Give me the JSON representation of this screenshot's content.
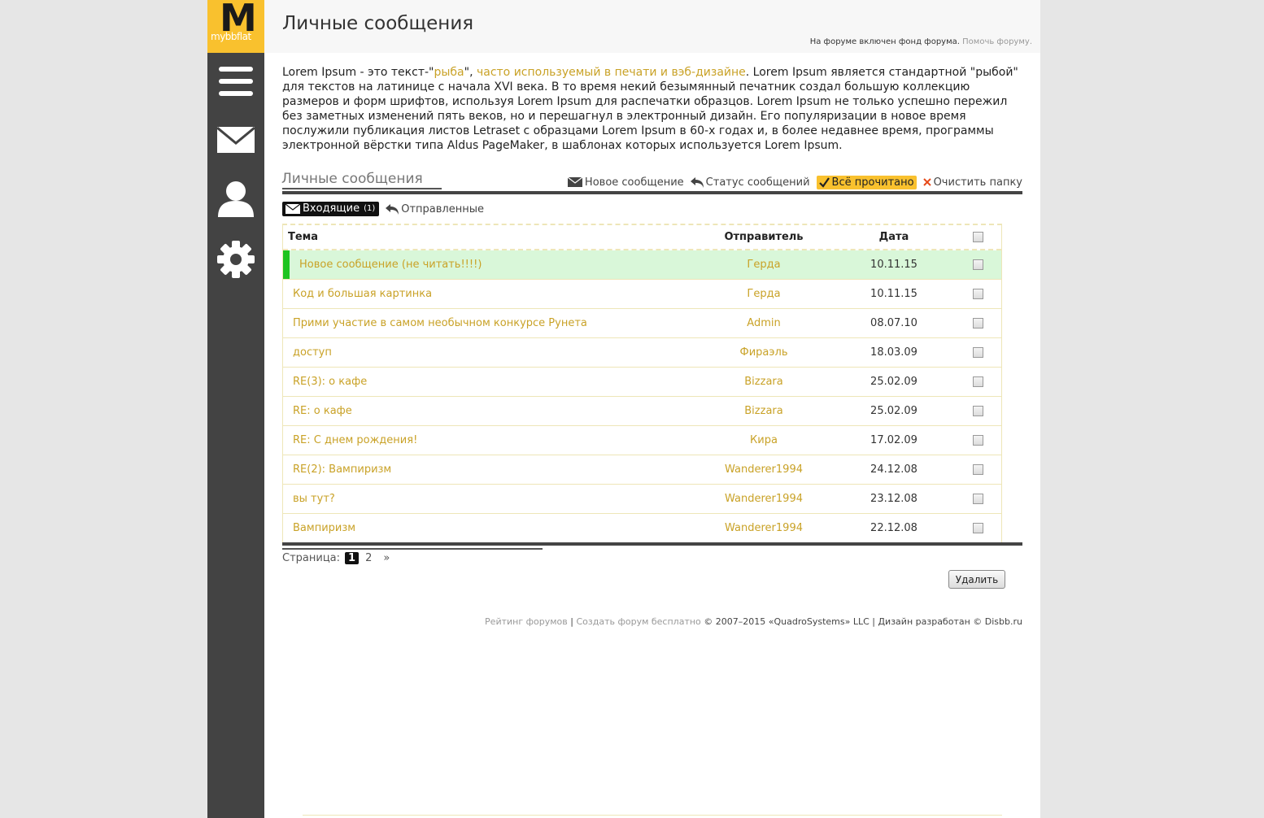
{
  "logo": {
    "letter": "M",
    "name": "mybbflat"
  },
  "sidebar": {
    "items": [
      {
        "icon": "menu-icon"
      },
      {
        "icon": "envelope-icon"
      },
      {
        "icon": "user-icon"
      },
      {
        "icon": "gear-icon"
      }
    ]
  },
  "header": {
    "title": "Личные сообщения",
    "fund_text": "На форуме включен фонд форума.",
    "fund_link": "Помочь форуму."
  },
  "intro": {
    "p1": "Lorem Ipsum - это текст-\"",
    "link1": "рыба",
    "p2": "\", ",
    "link2": "часто используемый в печати и вэб-дизайне",
    "p3": ". Lorem Ipsum является стандартной \"рыбой\" для текстов на латинице с начала XVI века. В то время некий безымянный печатник создал большую коллекцию размеров и форм шрифтов, используя Lorem Ipsum для распечатки образцов. Lorem Ipsum не только успешно пережил без заметных изменений пять веков, но и перешагнул в электронный дизайн. Его популяризации в новое время послужили публикация листов Letraset с образцами Lorem Ipsum в 60-х годах и, в более недавнее время, программы электронной вёрстки типа Aldus PageMaker, в шаблонах которых используется Lorem Ipsum."
  },
  "pm": {
    "section_title": "Личные сообщения",
    "actions": {
      "new": "Новое сообщение",
      "status": "Статус сообщений",
      "read_all": "Всё прочитано",
      "clear": "Очистить папку"
    },
    "tabs": {
      "inbox": "Входящие",
      "inbox_count": "(1)",
      "sent": "Отправленные"
    },
    "columns": {
      "subject": "Тема",
      "sender": "Отправитель",
      "date": "Дата"
    },
    "rows": [
      {
        "subject": "Новое сообщение (не читать!!!!)",
        "sender": "Герда",
        "date": "10.11.15",
        "unread": true
      },
      {
        "subject": "Код и большая картинка",
        "sender": "Герда",
        "date": "10.11.15"
      },
      {
        "subject": "Прими участие в самом необычном конкурсе Рунета",
        "sender": "Admin",
        "date": "08.07.10"
      },
      {
        "subject": "доступ",
        "sender": "Фираэль",
        "date": "18.03.09"
      },
      {
        "subject": "RE(3): о кафе",
        "sender": "Bizzara",
        "date": "25.02.09"
      },
      {
        "subject": "RE: о кафе",
        "sender": "Bizzara",
        "date": "25.02.09"
      },
      {
        "subject": "RE: С днем рождения!",
        "sender": "Кира",
        "date": "17.02.09"
      },
      {
        "subject": "RE(2): Вампиризм",
        "sender": "Wanderer1994",
        "date": "24.12.08"
      },
      {
        "subject": "вы тут?",
        "sender": "Wanderer1994",
        "date": "23.12.08"
      },
      {
        "subject": "Вампиризм",
        "sender": "Wanderer1994",
        "date": "22.12.08"
      }
    ],
    "pager": {
      "label": "Страница:",
      "current": "1",
      "page2": "2",
      "next": "»"
    },
    "delete_label": "Удалить"
  },
  "footer": {
    "link1": "Рейтинг форумов",
    "sep1": " | ",
    "link2": "Создать форум бесплатно",
    "rest": " © 2007–2015 «QuadroSystems» LLC | Дизайн разработан © Disbb.ru"
  },
  "colors": {
    "accent": "#f9c12e",
    "link": "#c9a227",
    "sidebar": "#434343",
    "unread_bg": "#d9f7d9",
    "unread_marker": "#1fc41f"
  }
}
